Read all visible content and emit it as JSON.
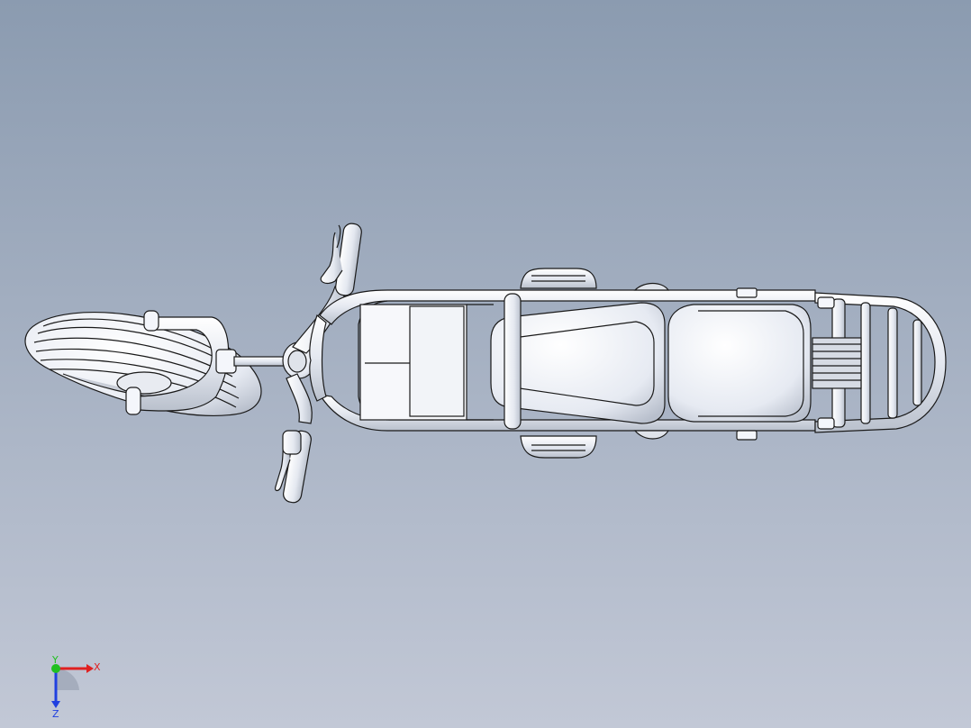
{
  "viewport": {
    "background_top": "#8b9bb0",
    "background_bottom": "#c2c8d6"
  },
  "model": {
    "part_fill": "#f4f6fb",
    "edge_color": "#1a1a1a",
    "shade_color": "#c9ced8"
  },
  "triad": {
    "x_label": "X",
    "y_label": "Y",
    "z_label": "Z",
    "x_color": "#e02020",
    "y_color": "#20c020",
    "z_color": "#2040e0"
  }
}
